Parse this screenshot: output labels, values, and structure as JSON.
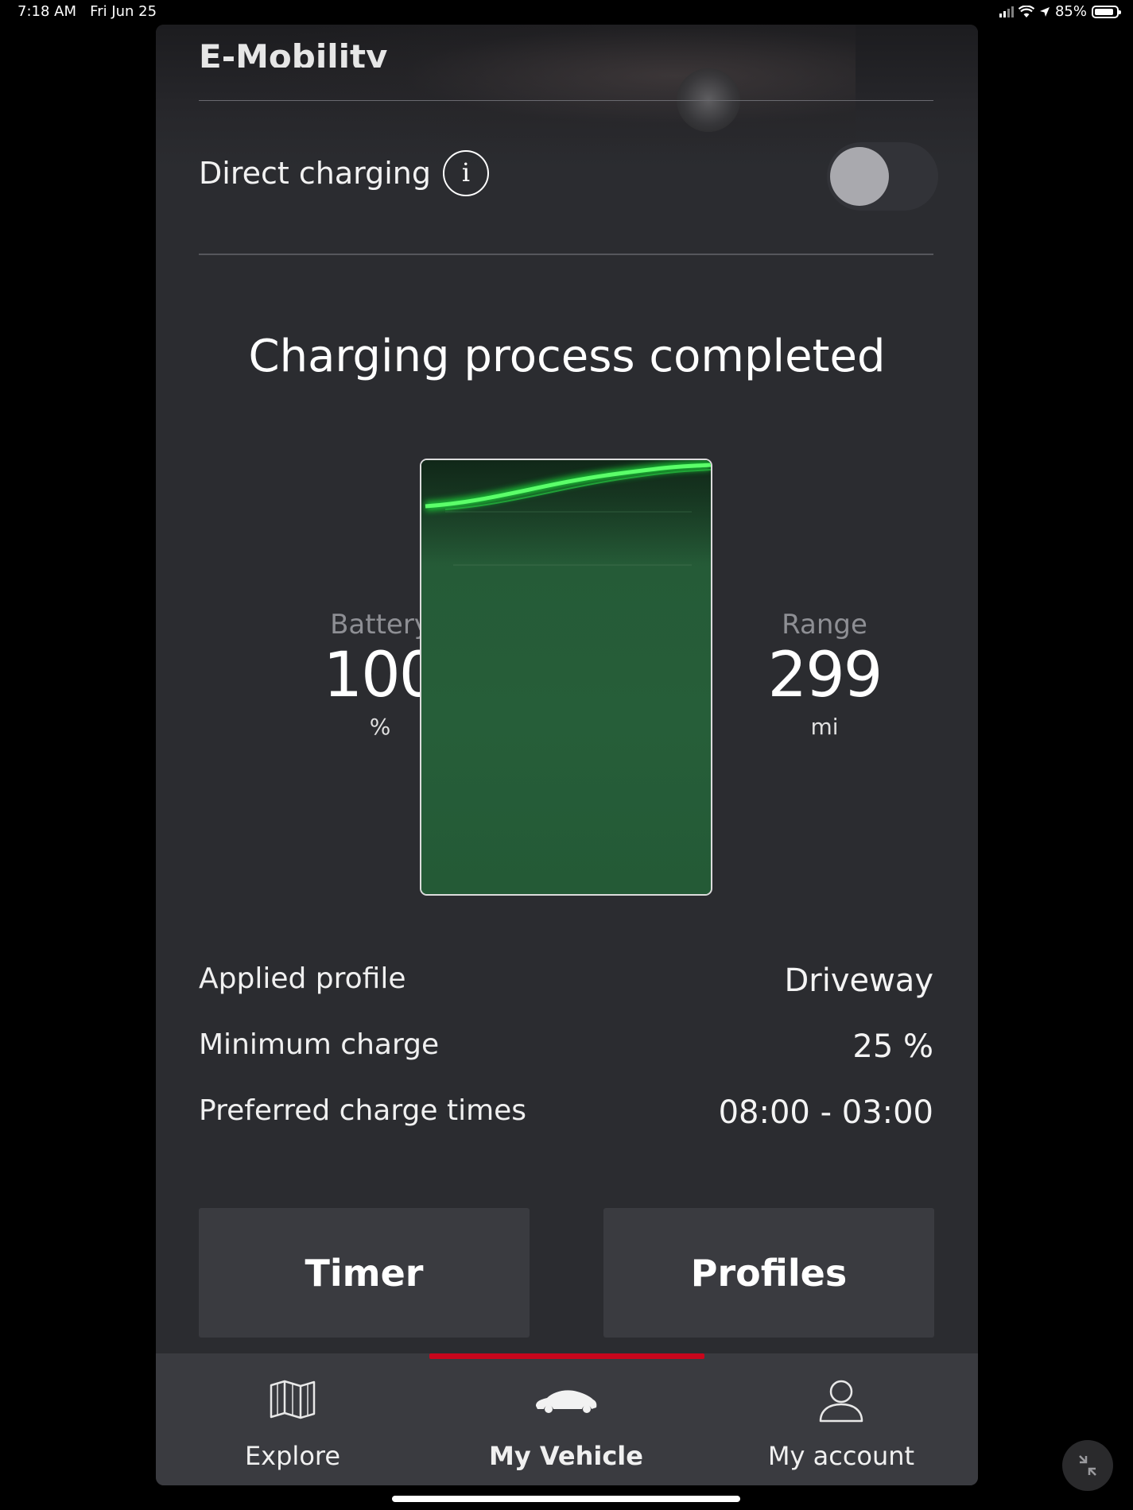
{
  "status_bar": {
    "time": "7:18 AM",
    "date": "Fri Jun 25",
    "battery_pct": "85%"
  },
  "header": {
    "title": "E-Mobility"
  },
  "direct_charging": {
    "label": "Direct charging",
    "info_icon": "info-icon",
    "enabled": false
  },
  "charge": {
    "heading": "Charging process completed",
    "battery_label": "Battery",
    "battery_value": "100",
    "battery_unit": "%",
    "range_label": "Range",
    "range_value": "299",
    "range_unit": "mi",
    "level": 1.0,
    "accent": "#1ee03a"
  },
  "details": [
    {
      "key": "Applied profile",
      "value": "Driveway"
    },
    {
      "key": "Minimum charge",
      "value": "25 %"
    },
    {
      "key": "Preferred charge times",
      "value": "08:00 - 03:00"
    }
  ],
  "buttons": {
    "timer": "Timer",
    "profiles": "Profiles"
  },
  "tabs": [
    {
      "label": "Explore",
      "icon": "map-icon",
      "active": false
    },
    {
      "label": "My Vehicle",
      "icon": "car-icon",
      "active": true
    },
    {
      "label": "My account",
      "icon": "person-icon",
      "active": false
    }
  ],
  "colors": {
    "tab_indicator": "#c8061c",
    "panel": "#2b2c30"
  }
}
